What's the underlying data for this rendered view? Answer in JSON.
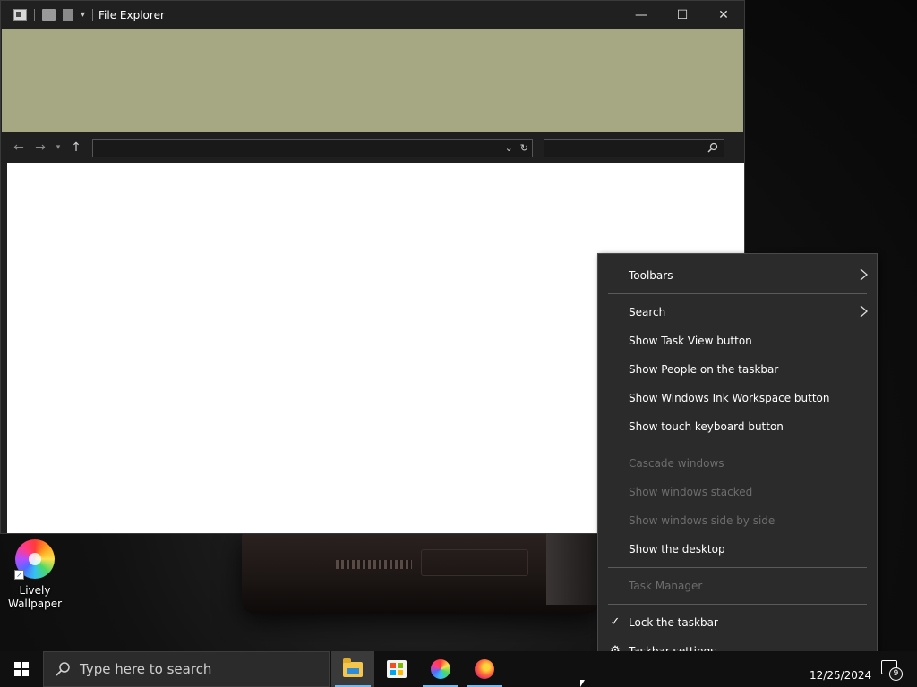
{
  "window": {
    "title": "File Explorer",
    "controls": {
      "minimize": "—",
      "maximize": "☐",
      "close": "✕"
    },
    "address_value": "",
    "search_placeholder": ""
  },
  "desktop": {
    "icons": [
      {
        "label": "Lively Wallpaper"
      }
    ]
  },
  "context_menu": {
    "items": [
      {
        "label": "Toolbars",
        "enabled": true,
        "submenu": true
      },
      {
        "label": "Search",
        "enabled": true,
        "submenu": true
      },
      {
        "label": "Show Task View button",
        "enabled": true
      },
      {
        "label": "Show People on the taskbar",
        "enabled": true
      },
      {
        "label": "Show Windows Ink Workspace button",
        "enabled": true
      },
      {
        "label": "Show touch keyboard button",
        "enabled": true
      },
      {
        "label": "Cascade windows",
        "enabled": false
      },
      {
        "label": "Show windows stacked",
        "enabled": false
      },
      {
        "label": "Show windows side by side",
        "enabled": false
      },
      {
        "label": "Show the desktop",
        "enabled": true
      },
      {
        "label": "Task Manager",
        "enabled": false
      },
      {
        "label": "Lock the taskbar",
        "enabled": true,
        "checked": true
      },
      {
        "label": "Taskbar settings",
        "enabled": true,
        "icon": "gear-icon"
      }
    ]
  },
  "taskbar": {
    "search_placeholder": "Type here to search",
    "apps": [
      "file-explorer",
      "microsoft-store",
      "color-app",
      "firefox"
    ],
    "clock_date": "12/25/2024",
    "notification_count": "9"
  },
  "colors": {
    "ribbon": "#a5a882",
    "menu_bg": "#2b2b2b",
    "taskbar": "#101010",
    "accent": "#76b9ed"
  }
}
